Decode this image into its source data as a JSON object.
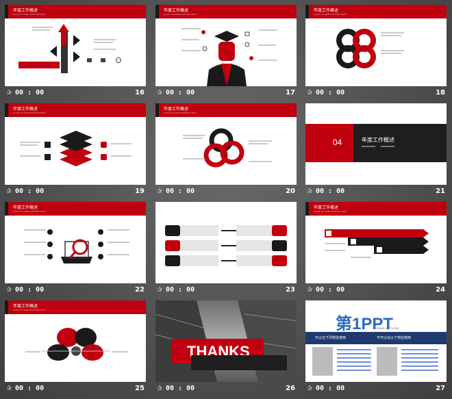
{
  "slide_header": {
    "title": "年度工作概述",
    "subtitle": "CLICK TO ADD CAPTION TEXT"
  },
  "footer_time": "00 : 00",
  "slides": [
    {
      "number": "16"
    },
    {
      "number": "17"
    },
    {
      "number": "18"
    },
    {
      "number": "19"
    },
    {
      "number": "20"
    },
    {
      "number": "21",
      "section_number": "04",
      "section_title": "年度工作概述"
    },
    {
      "number": "22"
    },
    {
      "number": "23"
    },
    {
      "number": "24"
    },
    {
      "number": "25"
    },
    {
      "number": "26",
      "thanks_text": "THANKS"
    },
    {
      "number": "27",
      "logo_text": "第1PPT",
      "logo_sub": "WWW.1PPT.COM",
      "left_heading": "可以在下列地址使用",
      "right_heading": "不可以在以下地址使用"
    }
  ],
  "icons": {
    "star": "star-icon",
    "accent": "#c0000e",
    "dark": "#1a1a1a"
  }
}
